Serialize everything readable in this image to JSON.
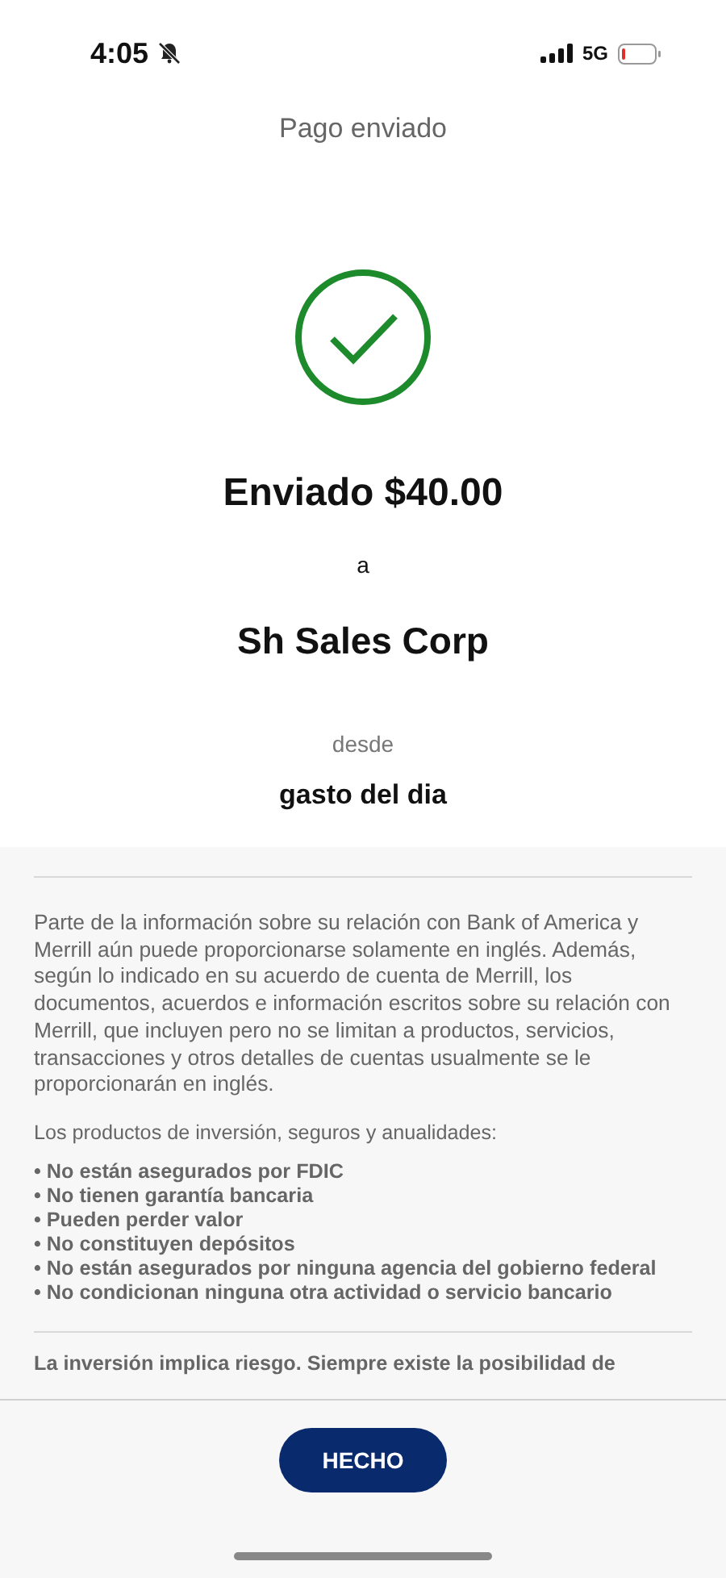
{
  "status_bar": {
    "time": "4:05",
    "network": "5G"
  },
  "header": {
    "title": "Pago enviado"
  },
  "confirmation": {
    "amount_line": "Enviado $40.00",
    "to_label": "a",
    "recipient": "Sh Sales Corp",
    "from_label": "desde",
    "account": "gasto del dia"
  },
  "disclosure": {
    "paragraph": "Parte de la información sobre su relación con Bank of America y Merrill aún puede proporcionarse solamente en inglés. Además, según lo indicado en su acuerdo de cuenta de Merrill, los documentos, acuerdos e información escritos sobre su relación con Merrill, que incluyen pero no se limitan a productos, servicios, transacciones y otros detalles de cuentas usualmente se le proporcionarán en inglés.",
    "products_intro": "Los productos de inversión, seguros y anualidades:",
    "bullets": [
      "• No están asegurados por FDIC",
      "• No tienen garantía bancaria",
      "• Pueden perder valor",
      "• No constituyen depósitos",
      "• No están asegurados por ninguna agencia del gobierno federal",
      "• No condicionan ninguna otra actividad o servicio bancario"
    ],
    "risk_text": "La inversión implica riesgo. Siempre existe la posibilidad de"
  },
  "footer": {
    "button": "HECHO"
  }
}
